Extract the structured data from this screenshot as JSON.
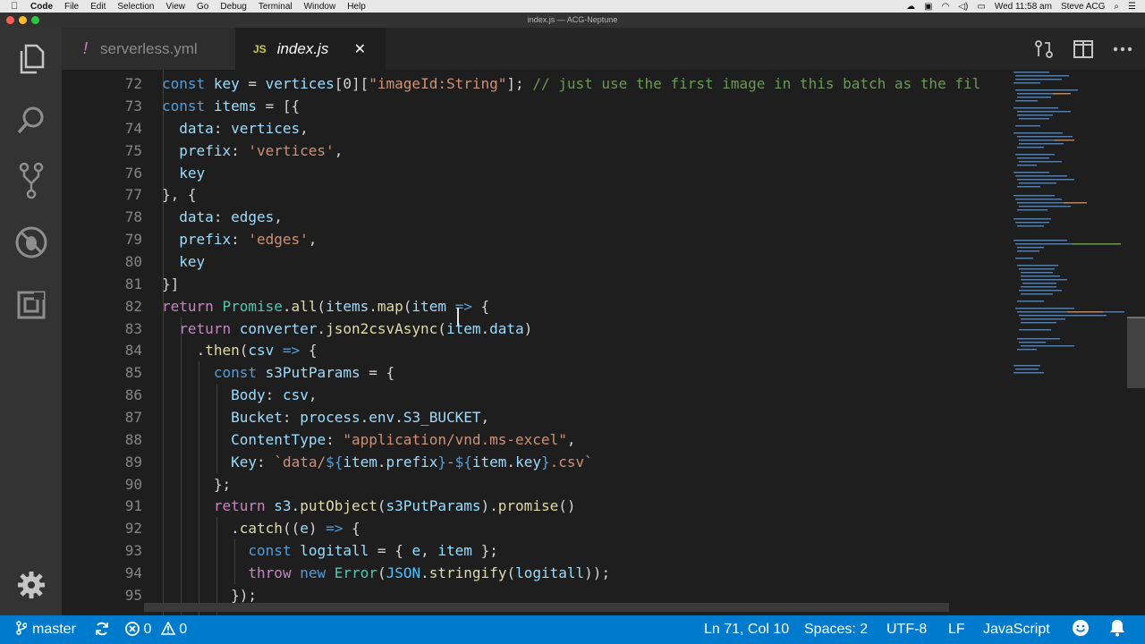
{
  "menubar": {
    "app_name": "Code",
    "items": [
      "File",
      "Edit",
      "Selection",
      "View",
      "Go",
      "Debug",
      "Terminal",
      "Window",
      "Help"
    ],
    "datetime": "Wed 11:58 am",
    "user": "Steve ACG"
  },
  "window": {
    "title": "index.js — ACG-Neptune"
  },
  "activity_bar": {
    "icons": [
      "files-icon",
      "search-icon",
      "source-control-icon",
      "debug-icon",
      "extensions-icon",
      "gear-icon"
    ]
  },
  "tabs": [
    {
      "icon_text": "!",
      "label": "serverless.yml",
      "active": false
    },
    {
      "icon_text": "JS",
      "label": "index.js",
      "active": true,
      "close": "✕"
    }
  ],
  "editor": {
    "line_numbers": [
      "72",
      "73",
      "74",
      "75",
      "76",
      "77",
      "78",
      "79",
      "80",
      "81",
      "82",
      "83",
      "84",
      "85",
      "86",
      "87",
      "88",
      "89",
      "90",
      "91",
      "92",
      "93",
      "94",
      "95"
    ],
    "lines": [
      "const key = vertices[0][\"imageId:String\"]; // just use the first image in this batch as the fil",
      "const items = [{",
      "  data: vertices,",
      "  prefix: 'vertices',",
      "  key",
      "}, {",
      "  data: edges,",
      "  prefix: 'edges',",
      "  key",
      "}]",
      "return Promise.all(items.map(item => {",
      "  return converter.json2csvAsync(item.data)",
      "    .then(csv => {",
      "      const s3PutParams = {",
      "        Body: csv,",
      "        Bucket: process.env.S3_BUCKET,",
      "        ContentType: \"application/vnd.ms-excel\",",
      "        Key: `data/${item.prefix}-${item.key}.csv`",
      "      };",
      "      return s3.putObject(s3PutParams).promise()",
      "        .catch((e) => {",
      "          const logitall = { e, item };",
      "          throw new Error(JSON.stringify(logitall));",
      "        });"
    ]
  },
  "statusbar": {
    "branch": "master",
    "errors": "0",
    "warnings": "0",
    "position": "Ln 71, Col 10",
    "spaces": "Spaces: 2",
    "encoding": "UTF-8",
    "eol": "LF",
    "language": "JavaScript"
  },
  "colors": {
    "status_bar": "#007acc",
    "activity_bar": "#333333",
    "editor_bg": "#1e1e1e",
    "keyword": "#569cd6",
    "control": "#c586c0",
    "function": "#dcdcaa",
    "variable": "#9cdcfe",
    "string": "#ce9178",
    "comment": "#6a9955"
  }
}
